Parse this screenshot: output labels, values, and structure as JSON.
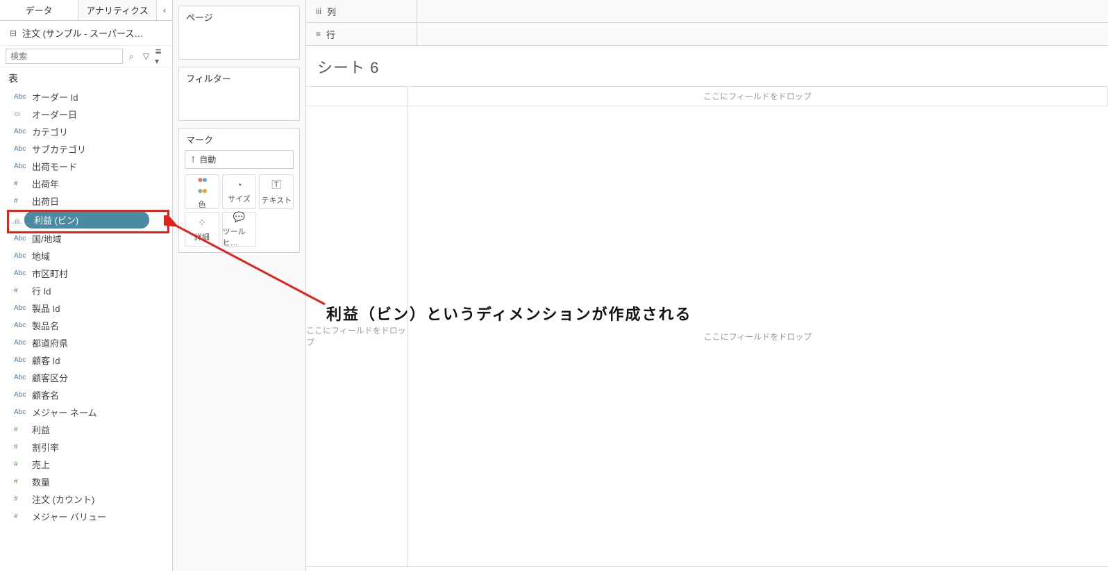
{
  "sidebar": {
    "tab_data": "データ",
    "tab_analytics": "アナリティクス",
    "datasource": "注文 (サンプル - スーパース…",
    "search_placeholder": "検索",
    "section_title": "表",
    "fields": [
      {
        "t": "abc",
        "label": "オーダー Id"
      },
      {
        "t": "date",
        "label": "オーダー日"
      },
      {
        "t": "abc",
        "label": "カテゴリ"
      },
      {
        "t": "abc",
        "label": "サブカテゴリ"
      },
      {
        "t": "abc",
        "label": "出荷モード"
      },
      {
        "t": "num",
        "label": "出荷年"
      },
      {
        "t": "num",
        "label": "出荷日"
      },
      {
        "t": "bin",
        "label": "利益 (ビン)",
        "highlight": true
      },
      {
        "t": "abc",
        "label": "国/地域"
      },
      {
        "t": "abc",
        "label": "地域"
      },
      {
        "t": "abc",
        "label": "市区町村"
      },
      {
        "t": "num",
        "label": "行 Id"
      },
      {
        "t": "abc",
        "label": "製品 Id"
      },
      {
        "t": "abc",
        "label": "製品名"
      },
      {
        "t": "abc",
        "label": "都道府県"
      },
      {
        "t": "abc",
        "label": "顧客 Id"
      },
      {
        "t": "abc",
        "label": "顧客区分"
      },
      {
        "t": "abc",
        "label": "顧客名"
      },
      {
        "t": "abc",
        "label": "メジャー ネーム"
      },
      {
        "t": "meas",
        "label": "利益"
      },
      {
        "t": "meas",
        "label": "割引率"
      },
      {
        "t": "meas",
        "label": "売上"
      },
      {
        "t": "meas",
        "label": "数量"
      },
      {
        "t": "meas",
        "label": "注文 (カウント)"
      },
      {
        "t": "meas",
        "label": "メジャー バリュー"
      }
    ]
  },
  "cards": {
    "pages": "ページ",
    "filters": "フィルター",
    "marks": "マーク",
    "mark_select": "自動",
    "cells": {
      "color": "色",
      "size": "サイズ",
      "text": "テキスト",
      "detail": "詳細",
      "tooltip": "ツールヒ…"
    }
  },
  "shelves": {
    "columns": "列",
    "rows": "行"
  },
  "sheet": {
    "title": "シート 6",
    "drop_here": "ここにフィールドをドロップ"
  },
  "annotation": "利益（ビン）というディメンションが作成される"
}
